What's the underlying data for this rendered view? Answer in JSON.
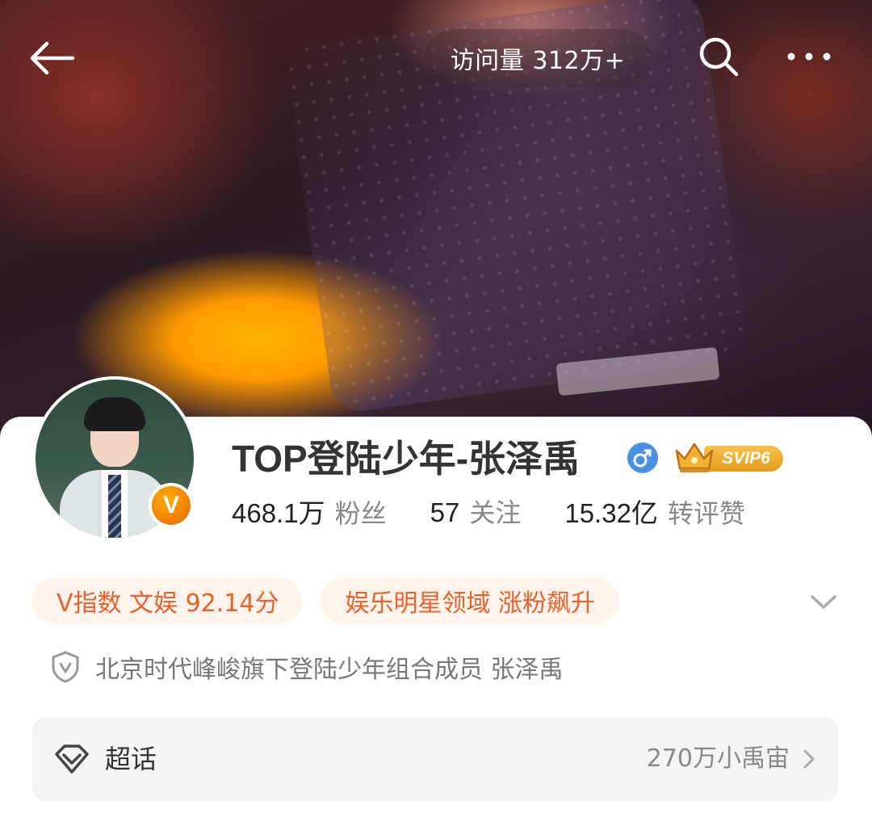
{
  "header": {
    "visits": "访问量 312万+"
  },
  "profile": {
    "username": "TOP登陆少年-张泽禹",
    "gender_icon": "male-icon",
    "svip_label": "SVIP6",
    "avatar_badge": "V",
    "stats": [
      {
        "num": "468.1万",
        "label": "粉丝"
      },
      {
        "num": "57",
        "label": "关注"
      },
      {
        "num": "15.32亿",
        "label": "转评赞"
      }
    ],
    "tags": [
      "V指数 文娱 92.14分",
      "娱乐明星领域 涨粉飙升"
    ],
    "verification": "北京时代峰峻旗下登陆少年组合成员 张泽禹"
  },
  "supertopic": {
    "title": "超话",
    "count": "270万小禹宙"
  },
  "colors": {
    "accent_orange": "#e8622c",
    "tag_bg": "#fff3ec",
    "gender_blue": "#4a90e2",
    "svip_gold": "#f0b030"
  }
}
